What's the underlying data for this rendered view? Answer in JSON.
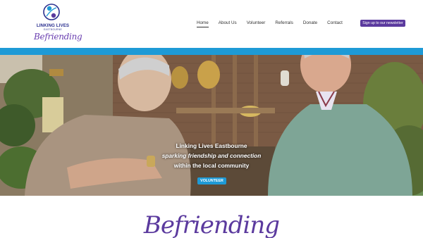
{
  "header": {
    "logo_title": "LINKING LIVES",
    "logo_subtitle": "EASTBOURNE",
    "logo_script": "Befriending",
    "nav": [
      {
        "label": "Home",
        "active": true
      },
      {
        "label": "About Us",
        "active": false
      },
      {
        "label": "Volunteer",
        "active": false
      },
      {
        "label": "Referrals",
        "active": false
      },
      {
        "label": "Donate",
        "active": false
      },
      {
        "label": "Contact",
        "active": false
      }
    ],
    "newsletter_button": "Sign up to our newsletter"
  },
  "hero": {
    "line1": "Linking Lives Eastbourne",
    "line2": "sparking friendship and connection",
    "line3": "within the local community",
    "button": "VOLUNTEER"
  },
  "section": {
    "title": "Befriending"
  },
  "colors": {
    "brand_purple": "#5b3a9e",
    "accent_blue": "#1e9ad6"
  }
}
